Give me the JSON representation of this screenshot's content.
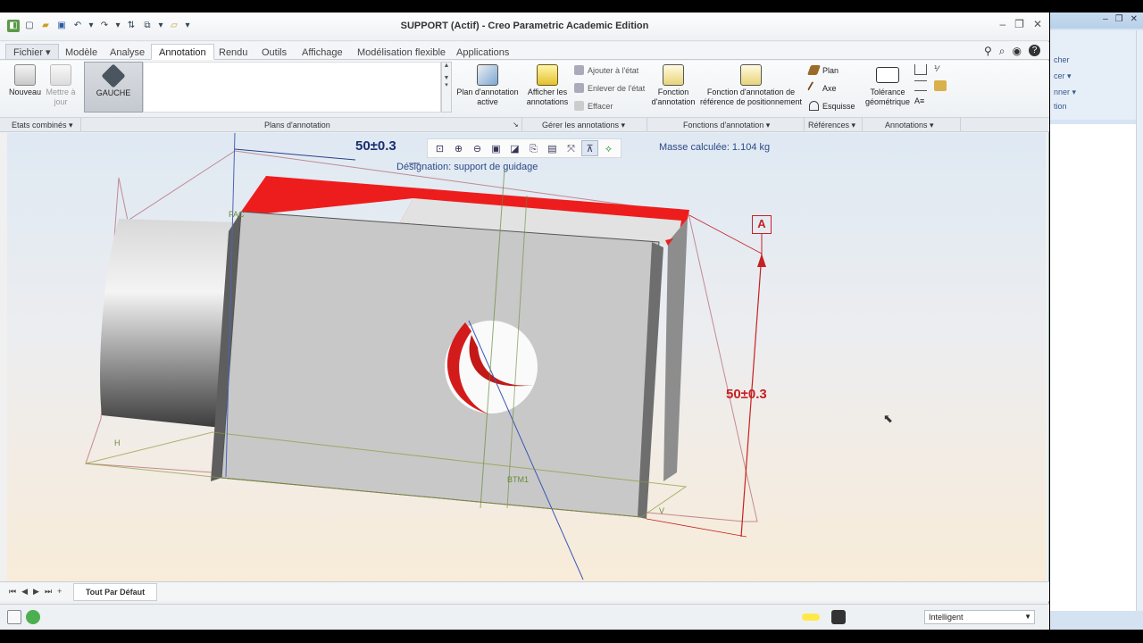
{
  "window": {
    "title": "SUPPORT (Actif) - Creo Parametric Academic Edition"
  },
  "tabs": [
    "Fichier ▾",
    "Modèle",
    "Analyse",
    "Annotation",
    "Rendu",
    "Outils",
    "Affichage",
    "Modélisation flexible",
    "Applications"
  ],
  "active_tab": "Annotation",
  "ribbon": {
    "nouveau": "Nouveau",
    "mettre_a_jour": "Mettre à jour",
    "gauche": "GAUCHE",
    "plan_annotation_active": "Plan d'annotation active",
    "afficher_annotations": "Afficher les annotations",
    "ajouter_etat": "Ajouter à l'état",
    "enlever_etat": "Enlever de l'état",
    "effacer": "Effacer",
    "fonction_annotation": "Fonction d'annotation",
    "fonction_ref_positionnement": "Fonction d'annotation de référence de positionnement",
    "plan": "Plan",
    "axe": "Axe",
    "esquisse": "Esquisse",
    "tolerance_geometrique": "Tolérance géométrique"
  },
  "groups": {
    "etats_combines": "Etats combinés ▾",
    "plans_annotation": "Plans d'annotation",
    "gerer_annotations": "Gérer les annotations ▾",
    "fonctions_annotation": "Fonctions d'annotation ▾",
    "references": "Références ▾",
    "annotations": "Annotations ▾"
  },
  "viewport": {
    "dimension_top": "50±0.3",
    "designation": "Désignation: support de guidage",
    "masse": "Masse calculée: 1.104  kg",
    "dimension_side": "50±0.3",
    "datum": "A",
    "label_fac": "FAC",
    "label_h": "H",
    "label_btm": "BTM1",
    "label_v": "V"
  },
  "view_toolbar_icons": [
    "zoom-fit-icon",
    "zoom-in-icon",
    "zoom-out-icon",
    "repaint-icon",
    "display-style-icon",
    "saved-views-icon",
    "view-manager-icon",
    "datum-display-icon",
    "annotation-display-icon",
    "spin-center-icon"
  ],
  "bottom": {
    "layout_tab": "Tout Par Défaut",
    "filter_value": "Intelligent"
  },
  "right_window": {
    "items": [
      "cher",
      "cer ▾",
      "nner ▾",
      "tion"
    ]
  }
}
